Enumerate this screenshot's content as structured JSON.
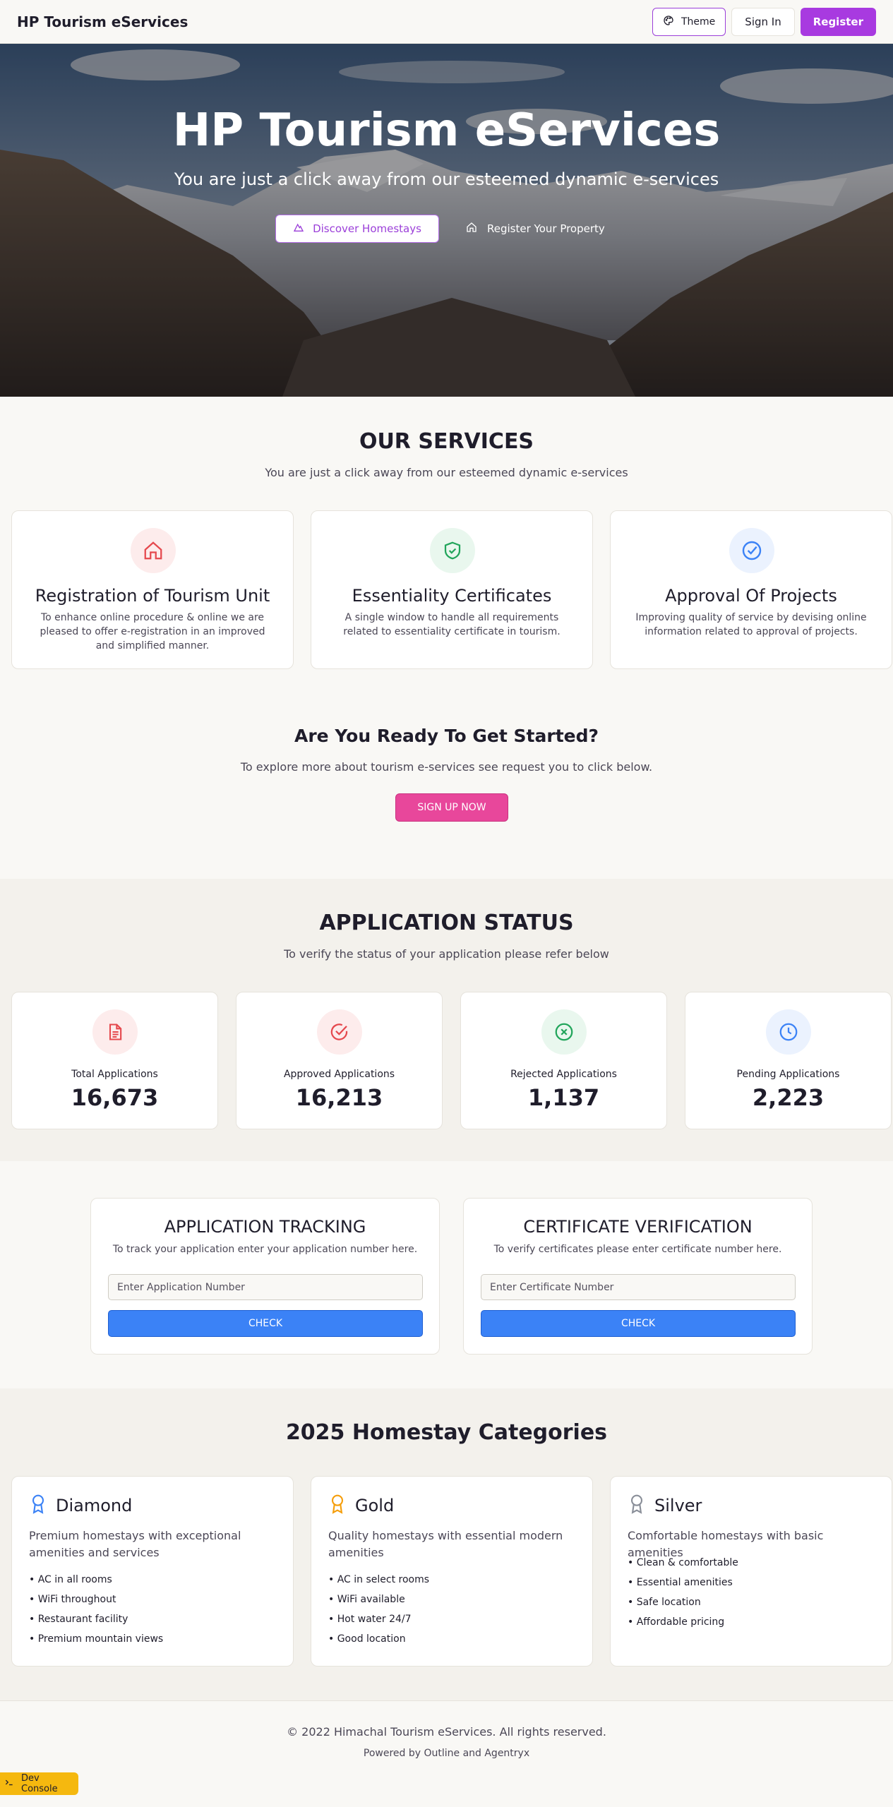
{
  "header": {
    "brand": "HP Tourism eServices",
    "theme_label": "Theme",
    "signin_label": "Sign In",
    "register_label": "Register"
  },
  "hero": {
    "title": "HP Tourism eServices",
    "subtitle": "You are just a click away from our esteemed dynamic e-services",
    "discover_label": "Discover Homestays",
    "register_property_label": "Register Your Property"
  },
  "services": {
    "title": "OUR SERVICES",
    "subtitle": "You are just a click away from our esteemed dynamic e-services",
    "items": [
      {
        "title": "Registration of Tourism Unit",
        "desc": "To enhance online procedure & online we are pleased to offer e-registration in an improved and simplified manner.",
        "icon": "home-icon",
        "color": "#e5484d"
      },
      {
        "title": "Essentiality Certificates",
        "desc": "A single window to handle all requirements related to essentiality certificate in tourism.",
        "icon": "shield-check-icon",
        "color": "#22a55b"
      },
      {
        "title": "Approval Of Projects",
        "desc": "Improving quality of service by devising online information related to approval of projects.",
        "icon": "circle-check-icon",
        "color": "#3b82f6"
      }
    ]
  },
  "cta": {
    "title": "Are You Ready To Get Started?",
    "subtitle": "To explore more about tourism e-services see request you to click below.",
    "button_label": "SIGN UP NOW"
  },
  "status": {
    "title": "APPLICATION STATUS",
    "subtitle": "To verify the status of your application please refer below",
    "items": [
      {
        "label": "Total Applications",
        "value": "16,673",
        "icon": "file-text-icon",
        "color": "#e5484d"
      },
      {
        "label": "Approved Applications",
        "value": "16,213",
        "icon": "circle-check-icon",
        "color": "#e5484d"
      },
      {
        "label": "Rejected Applications",
        "value": "1,137",
        "icon": "circle-x-icon",
        "color": "#22a55b"
      },
      {
        "label": "Pending Applications",
        "value": "2,223",
        "icon": "clock-icon",
        "color": "#3b82f6"
      }
    ]
  },
  "tracking": {
    "title": "APPLICATION TRACKING",
    "subtitle": "To track your application enter your application number here.",
    "placeholder": "Enter Application Number",
    "button_label": "CHECK"
  },
  "verification": {
    "title": "CERTIFICATE VERIFICATION",
    "subtitle": "To verify certificates please enter certificate number here.",
    "placeholder": "Enter Certificate Number",
    "button_label": "CHECK"
  },
  "categories": {
    "title": "2025 Homestay Categories",
    "items": [
      {
        "name": "Diamond",
        "desc": "Premium homestays with exceptional amenities and services",
        "color": "#3b82f6",
        "icon": "award-icon",
        "features": [
          "• AC in all rooms",
          "• WiFi throughout",
          "• Restaurant facility",
          "• Premium mountain views"
        ]
      },
      {
        "name": "Gold",
        "desc": "Quality homestays with essential modern amenities",
        "color": "#f59e0b",
        "icon": "award-icon",
        "features": [
          "• AC in select rooms",
          "• WiFi available",
          "• Hot water 24/7",
          "• Good location"
        ]
      },
      {
        "name": "Silver",
        "desc": "Comfortable homestays with basic amenities",
        "color": "#8a8f99",
        "icon": "award-icon",
        "features": [
          "• Clean & comfortable",
          "• Essential amenities",
          "• Safe location",
          "• Affordable pricing"
        ]
      }
    ]
  },
  "footer": {
    "copyright": "© 2022 Himachal Tourism eServices. All rights reserved.",
    "powered": "Powered by Outline and Agentryx"
  },
  "dev_console": {
    "label": "Dev Console"
  },
  "colors": {
    "brand_purple": "#a83ae0",
    "pink": "#e8479b",
    "blue": "#3b82f6"
  }
}
